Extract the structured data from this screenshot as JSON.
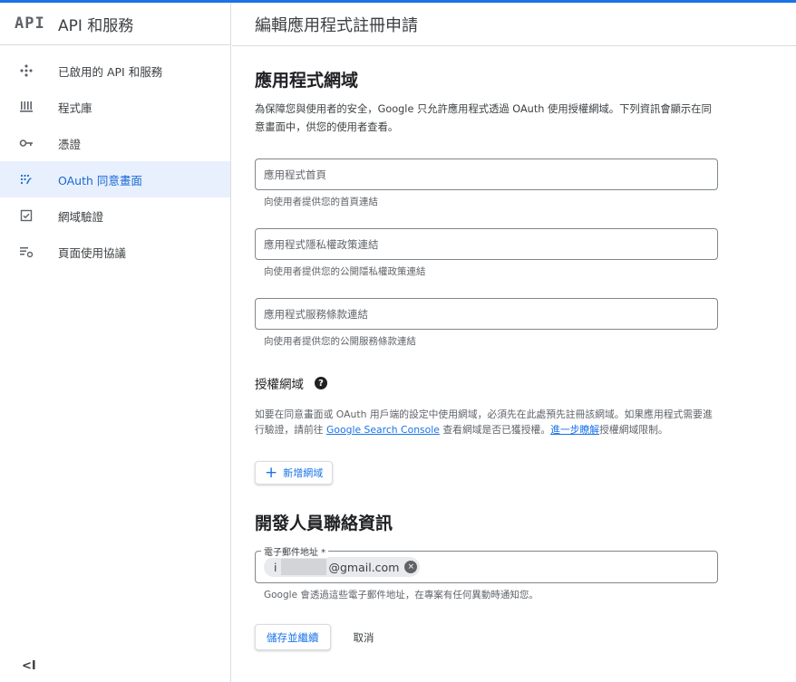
{
  "brand": {
    "logo": "API",
    "title": "API 和服務"
  },
  "sidebar": {
    "items": [
      {
        "label": "已啟用的 API 和服務",
        "icon": "enabled-apis-icon"
      },
      {
        "label": "程式庫",
        "icon": "library-icon"
      },
      {
        "label": "憑證",
        "icon": "key-icon"
      },
      {
        "label": "OAuth 同意畫面",
        "icon": "oauth-consent-icon",
        "active": true
      },
      {
        "label": "網域驗證",
        "icon": "checkbox-icon"
      },
      {
        "label": "頁面使用協議",
        "icon": "settings-list-icon"
      }
    ],
    "collapse": "<I"
  },
  "header": {
    "title": "編輯應用程式註冊申請"
  },
  "app_domain": {
    "title": "應用程式網域",
    "description": "為保障您與使用者的安全，Google 只允許應用程式透過 OAuth 使用授權網域。下列資訊會顯示在同意畫面中，供您的使用者查看。",
    "fields": [
      {
        "placeholder": "應用程式首頁",
        "hint": "向使用者提供您的首頁連結"
      },
      {
        "placeholder": "應用程式隱私權政策連結",
        "hint": "向使用者提供您的公開隱私權政策連結"
      },
      {
        "placeholder": "應用程式服務條款連結",
        "hint": "向使用者提供您的公開服務條款連結"
      }
    ]
  },
  "authorized_domains": {
    "title": "授權網域",
    "help": "?",
    "desc_part1": "如要在同意畫面或 OAuth 用戶端的設定中使用網域，必須先在此處預先註冊該網域。如果應用程式需要進行驗證，請前往 ",
    "link_console": "Google Search Console",
    "desc_part2": " 查看網域是否已獲授權。",
    "link_learn": "進一步瞭解",
    "desc_part3": "授權網域限制。",
    "add_button": "新增網域",
    "add_icon": "+"
  },
  "developer_contact": {
    "title": "開發人員聯絡資訊",
    "email_label": "電子郵件地址 *",
    "email_prefix": "i",
    "email_suffix": "@gmail.com",
    "chip_close": "×",
    "hint": "Google 會透過這些電子郵件地址，在專案有任何異動時通知您。"
  },
  "actions": {
    "save": "儲存並繼續",
    "cancel": "取消"
  },
  "colors": {
    "accent": "#1a73e8",
    "active_bg": "#e8f0fe",
    "border": "#dadce0"
  }
}
